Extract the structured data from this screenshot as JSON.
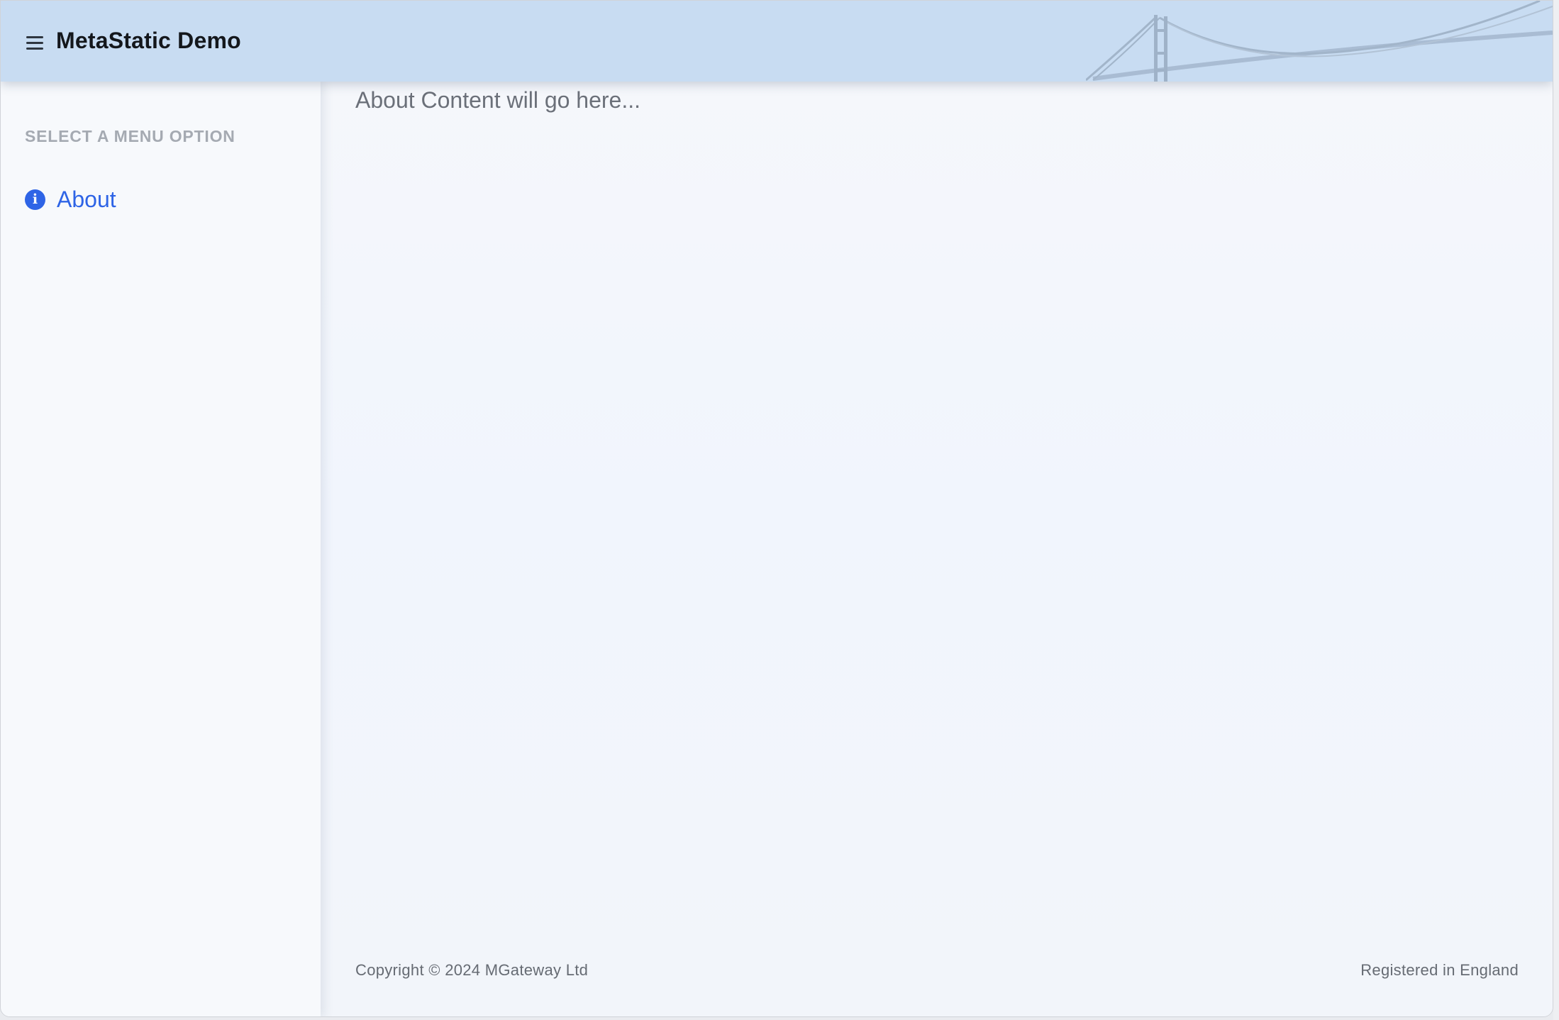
{
  "header": {
    "title": "MetaStatic Demo",
    "menu_icon": "hamburger-menu-icon",
    "decoration": "suspension-bridge-illustration",
    "background_color": "#c8dcf2"
  },
  "sidebar": {
    "heading": "SELECT A MENU OPTION",
    "items": [
      {
        "label": "About",
        "icon": "info-circle-icon",
        "color": "#2e64e6"
      }
    ]
  },
  "main": {
    "content_text": "About Content will go here..."
  },
  "footer": {
    "copyright": "Copyright © 2024 MGateway Ltd",
    "registered": "Registered in England"
  },
  "colors": {
    "accent": "#2e64e6",
    "page_background": "#f2f5fb"
  }
}
